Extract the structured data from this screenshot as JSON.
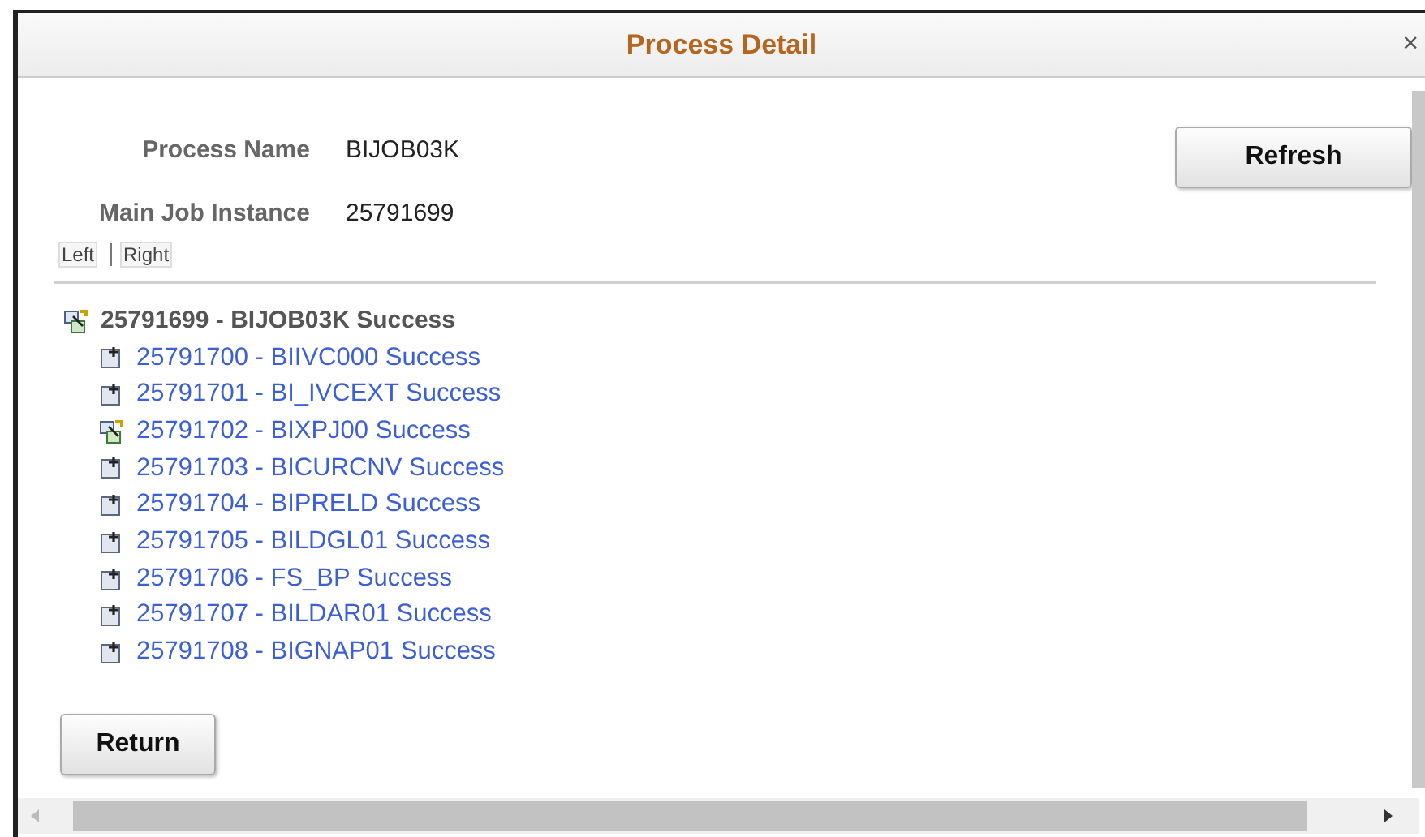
{
  "dialog": {
    "title": "Process Detail",
    "close": "×"
  },
  "fields": [
    {
      "label": "Process Name",
      "value": "BIJOB03K"
    },
    {
      "label": "Main Job Instance",
      "value": "25791699"
    }
  ],
  "refresh_button": "Refresh",
  "nav_links": [
    "Left",
    "Right"
  ],
  "tree": {
    "kind": "jobset",
    "label": "25791699 - BIJOB03K Success",
    "children": [
      {
        "kind": "process",
        "label": "25791700 - BIIVC000 Success"
      },
      {
        "kind": "process",
        "label": "25791701 - BI_IVCEXT Success"
      },
      {
        "kind": "jobset",
        "label": "25791702 - BIXPJ00 Success"
      },
      {
        "kind": "process",
        "label": "25791703 - BICURCNV Success"
      },
      {
        "kind": "process",
        "label": "25791704 - BIPRELD Success"
      },
      {
        "kind": "process",
        "label": "25791705 - BILDGL01 Success"
      },
      {
        "kind": "process",
        "label": "25791706 - FS_BP Success"
      },
      {
        "kind": "process",
        "label": "25791707 - BILDAR01 Success"
      },
      {
        "kind": "process",
        "label": "25791708 - BIGNAP01 Success"
      }
    ]
  },
  "return_button": "Return"
}
